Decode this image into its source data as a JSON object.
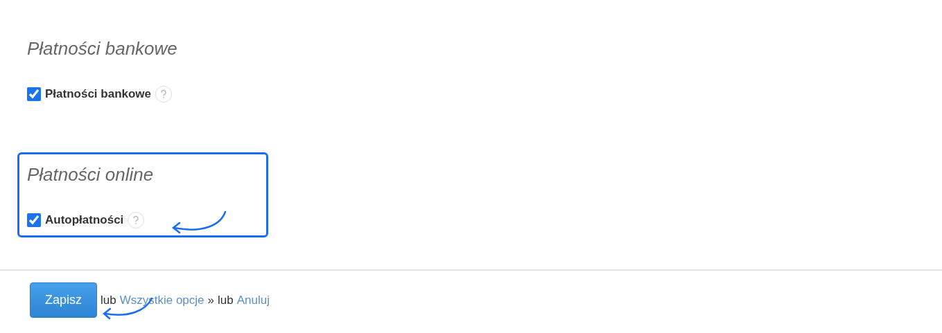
{
  "sections": [
    {
      "title": "Płatności bankowe",
      "highlighted": false,
      "options": [
        {
          "label": "Płatności bankowe",
          "checked": true
        }
      ]
    },
    {
      "title": "Płatności online",
      "highlighted": true,
      "options": [
        {
          "label": "Autopłatności",
          "checked": true
        }
      ]
    }
  ],
  "footer": {
    "save_button": "Zapisz",
    "parts": [
      {
        "kind": "text",
        "text": "lub"
      },
      {
        "kind": "link",
        "text": "Wszystkie opcje"
      },
      {
        "kind": "text",
        "text": "»"
      },
      {
        "kind": "text",
        "text": "lub"
      },
      {
        "kind": "link",
        "text": "Anuluj"
      }
    ]
  }
}
